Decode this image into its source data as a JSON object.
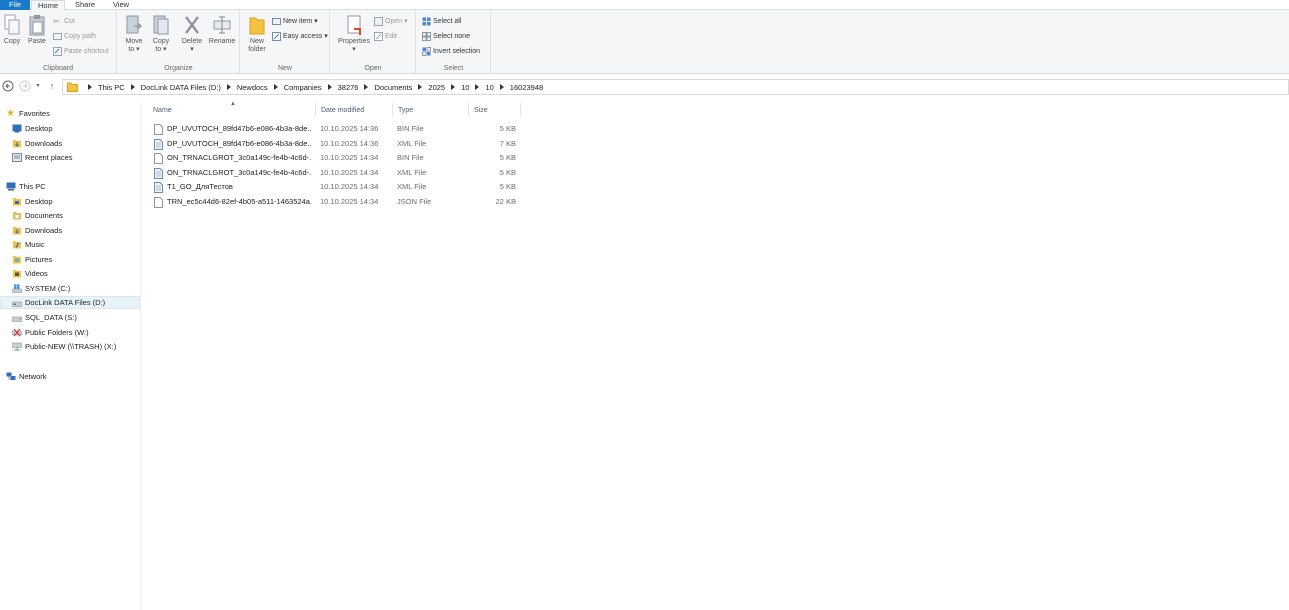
{
  "tabs": {
    "file": "File",
    "home": "Home",
    "share": "Share",
    "view": "View"
  },
  "ribbon": {
    "clipboard": {
      "label": "Clipboard",
      "copy": "Copy",
      "paste": "Paste",
      "cut": "Cut",
      "copy_path": "Copy path",
      "paste_shortcut": "Paste shortcut"
    },
    "organize": {
      "label": "Organize",
      "move_to": "Move",
      "move_to_2": "to",
      "copy_to": "Copy",
      "copy_to_2": "to",
      "delete": "Delete",
      "rename": "Rename"
    },
    "new": {
      "label": "New",
      "new_folder": "New",
      "new_folder_2": "folder",
      "new_item": "New item",
      "easy_access": "Easy access"
    },
    "open": {
      "label": "Open",
      "properties": "Properties",
      "open": "Open",
      "edit": "Edit"
    },
    "select": {
      "label": "Select",
      "select_all": "Select all",
      "select_none": "Select none",
      "invert": "Invert selection"
    }
  },
  "breadcrumbs": [
    "This PC",
    "DocLink DATA Files (D:)",
    "Newdocs",
    "Companies",
    "38276",
    "Documents",
    "2025",
    "10",
    "10",
    "16023948"
  ],
  "nav": {
    "favorites": "Favorites",
    "fav_items": [
      "Desktop",
      "Downloads",
      "Recent places"
    ],
    "this_pc": "This PC",
    "pc_items": [
      "Desktop",
      "Documents",
      "Downloads",
      "Music",
      "Pictures",
      "Videos",
      "SYSTEM (C:)",
      "DocLink DATA Files (D:)",
      "SQL_DATA (S:)",
      "Public Folders (W:)",
      "Public-NEW (\\\\TRASH) (X:)"
    ],
    "network": "Network"
  },
  "columns": {
    "name": "Name",
    "date": "Date modified",
    "type": "Type",
    "size": "Size"
  },
  "files": [
    {
      "name": "DP_UVUTOCH_89fd47b6-e086-4b3a-8de...",
      "date": "10.10.2025 14:36",
      "type": "BIN File",
      "size": "5 KB",
      "icon": "generic-file-icon"
    },
    {
      "name": "DP_UVUTOCH_89fd47b6-e086-4b3a-8de...",
      "date": "10.10.2025 14:36",
      "type": "XML File",
      "size": "7 KB",
      "icon": "xml-file-icon"
    },
    {
      "name": "ON_TRNACLGROT_3c0a149c-fe4b-4c6d-...",
      "date": "10.10.2025 14:34",
      "type": "BIN File",
      "size": "5 KB",
      "icon": "generic-file-icon"
    },
    {
      "name": "ON_TRNACLGROT_3c0a149c-fe4b-4c6d-...",
      "date": "10.10.2025 14:34",
      "type": "XML File",
      "size": "5 KB",
      "icon": "xml-file-icon"
    },
    {
      "name": "T1_GO_ДляТестов",
      "date": "10.10.2025 14:34",
      "type": "XML File",
      "size": "5 KB",
      "icon": "xml-file-icon"
    },
    {
      "name": "TRN_ec5c44d6-82ef-4b05-a511-1463524a...",
      "date": "10.10.2025 14:34",
      "type": "JSON File",
      "size": "22 KB",
      "icon": "generic-file-icon"
    }
  ]
}
